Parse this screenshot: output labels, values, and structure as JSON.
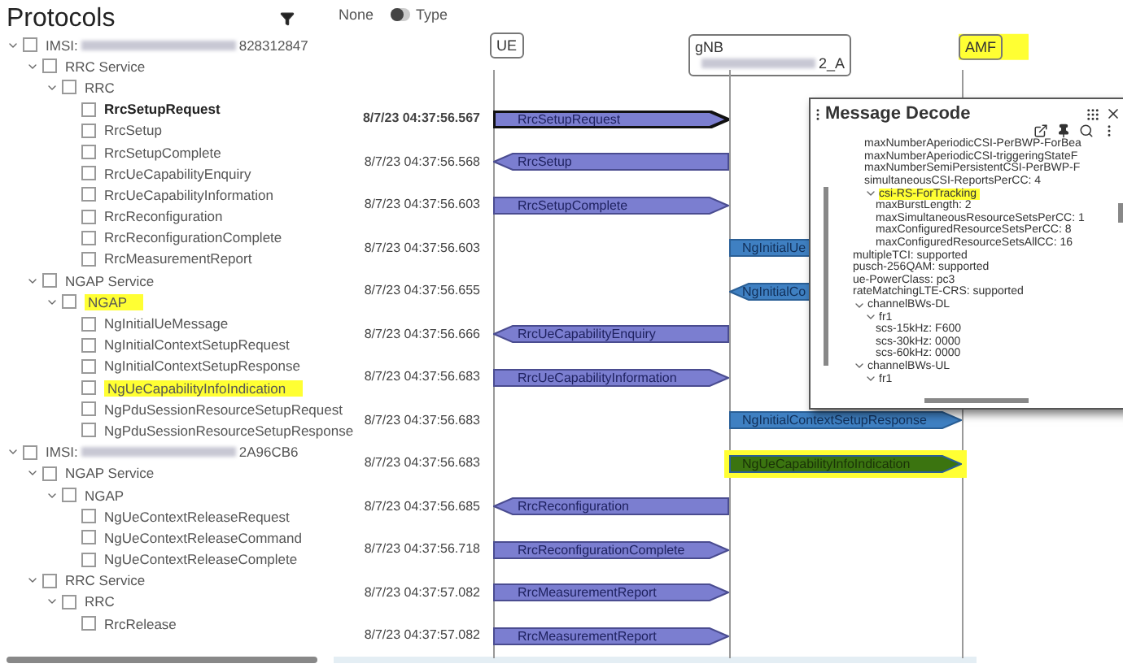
{
  "sidebar": {
    "title": "Protocols",
    "tree": [
      {
        "label": "IMSI:",
        "tail": "828312847",
        "redacted": true,
        "expanded": true,
        "checked": false,
        "children": [
          {
            "label": "RRC Service",
            "expanded": true,
            "checked": false,
            "children": [
              {
                "label": "RRC",
                "expanded": true,
                "checked": false,
                "children": [
                  {
                    "label": "RrcSetupRequest",
                    "checked": false,
                    "bold": true,
                    "highlighted": false
                  },
                  {
                    "label": "RrcSetup",
                    "checked": false,
                    "bold": false,
                    "highlighted": false
                  },
                  {
                    "label": "RrcSetupComplete",
                    "checked": false,
                    "bold": false,
                    "highlighted": false
                  },
                  {
                    "label": "RrcUeCapabilityEnquiry",
                    "checked": false,
                    "bold": false,
                    "highlighted": false
                  },
                  {
                    "label": "RrcUeCapabilityInformation",
                    "checked": false,
                    "bold": false,
                    "highlighted": false
                  },
                  {
                    "label": "RrcReconfiguration",
                    "checked": false,
                    "bold": false,
                    "highlighted": false
                  },
                  {
                    "label": "RrcReconfigurationComplete",
                    "checked": false,
                    "bold": false,
                    "highlighted": false
                  },
                  {
                    "label": "RrcMeasurementReport",
                    "checked": false,
                    "bold": false,
                    "highlighted": false
                  }
                ]
              }
            ]
          },
          {
            "label": "NGAP Service",
            "expanded": true,
            "checked": false,
            "children": [
              {
                "label": "NGAP",
                "expanded": true,
                "checked": false,
                "highlighted": true,
                "children": [
                  {
                    "label": "NgInitialUeMessage",
                    "checked": false,
                    "bold": false,
                    "highlighted": false
                  },
                  {
                    "label": "NgInitialContextSetupRequest",
                    "checked": false,
                    "bold": false,
                    "highlighted": false
                  },
                  {
                    "label": "NgInitialContextSetupResponse",
                    "checked": false,
                    "bold": false,
                    "highlighted": false
                  },
                  {
                    "label": "NgUeCapabilityInfoIndication",
                    "checked": false,
                    "bold": false,
                    "highlighted": true
                  },
                  {
                    "label": "NgPduSessionResourceSetupRequest",
                    "checked": false,
                    "bold": false,
                    "highlighted": false
                  },
                  {
                    "label": "NgPduSessionResourceSetupResponse",
                    "checked": false,
                    "bold": false,
                    "highlighted": false
                  }
                ]
              }
            ]
          }
        ]
      },
      {
        "label": "IMSI:",
        "tail": "2A96CB6",
        "redacted": true,
        "expanded": true,
        "checked": false,
        "children": [
          {
            "label": "NGAP Service",
            "expanded": true,
            "checked": false,
            "children": [
              {
                "label": "NGAP",
                "expanded": true,
                "checked": false,
                "children": [
                  {
                    "label": "NgUeContextReleaseRequest",
                    "checked": false,
                    "bold": false,
                    "highlighted": false
                  },
                  {
                    "label": "NgUeContextReleaseCommand",
                    "checked": false,
                    "bold": false,
                    "highlighted": false
                  },
                  {
                    "label": "NgUeContextReleaseComplete",
                    "checked": false,
                    "bold": false,
                    "highlighted": false
                  }
                ]
              }
            ]
          },
          {
            "label": "RRC Service",
            "expanded": true,
            "checked": false,
            "children": [
              {
                "label": "RRC",
                "expanded": true,
                "checked": false,
                "children": [
                  {
                    "label": "RrcRelease",
                    "checked": false,
                    "bold": false,
                    "highlighted": false
                  }
                ]
              }
            ]
          }
        ]
      }
    ]
  },
  "toolbar": {
    "option": "None",
    "toggle_label": "Type",
    "toggle_on": false
  },
  "lanes": [
    {
      "name": "UE",
      "highlighted": false
    },
    {
      "name": "gNB",
      "tail": "2_A",
      "redacted": true,
      "highlighted": false
    },
    {
      "name": "AMF",
      "highlighted": true
    }
  ],
  "messages": [
    {
      "time": "8/7/23 04:37:56.567",
      "label": "RrcSetupRequest",
      "kind": "rrc",
      "rightward": true,
      "selected": true,
      "highlighted": false
    },
    {
      "time": "8/7/23 04:37:56.568",
      "label": "RrcSetup",
      "kind": "rrc",
      "rightward": false,
      "selected": false,
      "highlighted": false
    },
    {
      "time": "8/7/23 04:37:56.603",
      "label": "RrcSetupComplete",
      "kind": "rrc",
      "rightward": true,
      "selected": false,
      "highlighted": false
    },
    {
      "time": "8/7/23 04:37:56.603",
      "label": "NgInitialUe",
      "kind": "ngap",
      "rightward": true,
      "selected": false,
      "highlighted": false
    },
    {
      "time": "8/7/23 04:37:56.655",
      "label": "NgInitialCo",
      "kind": "ngap",
      "rightward": false,
      "selected": false,
      "highlighted": false
    },
    {
      "time": "8/7/23 04:37:56.666",
      "label": "RrcUeCapabilityEnquiry",
      "kind": "rrc",
      "rightward": false,
      "selected": false,
      "highlighted": false
    },
    {
      "time": "8/7/23 04:37:56.683",
      "label": "RrcUeCapabilityInformation",
      "kind": "rrc",
      "rightward": true,
      "selected": false,
      "highlighted": false
    },
    {
      "time": "8/7/23 04:37:56.683",
      "label": "NgInitialContextSetupResponse",
      "kind": "ngap",
      "rightward": true,
      "selected": false,
      "highlighted": false
    },
    {
      "time": "8/7/23 04:37:56.683",
      "label": "NgUeCapabilityInfoIndication",
      "kind": "ngap",
      "rightward": true,
      "selected": false,
      "highlighted": true
    },
    {
      "time": "8/7/23 04:37:56.685",
      "label": "RrcReconfiguration",
      "kind": "rrc",
      "rightward": false,
      "selected": false,
      "highlighted": false
    },
    {
      "time": "8/7/23 04:37:56.718",
      "label": "RrcReconfigurationComplete",
      "kind": "rrc",
      "rightward": true,
      "selected": false,
      "highlighted": false
    },
    {
      "time": "8/7/23 04:37:57.082",
      "label": "RrcMeasurementReport",
      "kind": "rrc",
      "rightward": true,
      "selected": false,
      "highlighted": false
    },
    {
      "time": "8/7/23 04:37:57.082",
      "label": "RrcMeasurementReport",
      "kind": "rrc",
      "rightward": true,
      "selected": false,
      "highlighted": false
    }
  ],
  "decode": {
    "title": "Message Decode",
    "tree": [
      {
        "children": [
          {
            "label": "maxNumberAperiodicCSI-PerBWP-ForBea"
          },
          {
            "label": "maxNumberAperiodicCSI-triggeringStateF"
          },
          {
            "label": "maxNumberSemiPersistentCSI-PerBWP-F"
          },
          {
            "label": "simultaneousCSI-ReportsPerCC: 4"
          },
          {
            "label": "csi-RS-ForTracking",
            "expanded": true,
            "highlighted": true,
            "children": [
              {
                "label": "maxBurstLength: 2"
              },
              {
                "label": "maxSimultaneousResourceSetsPerCC: 1"
              },
              {
                "label": "maxConfiguredResourceSetsPerCC: 8"
              },
              {
                "label": "maxConfiguredResourceSetsAllCC: 16"
              }
            ]
          }
        ]
      },
      {
        "label": "multipleTCI: supported"
      },
      {
        "label": "pusch-256QAM: supported"
      },
      {
        "label": "ue-PowerClass: pc3"
      },
      {
        "label": "rateMatchingLTE-CRS: supported"
      },
      {
        "label": "channelBWs-DL",
        "expanded": true,
        "children": [
          {
            "label": "fr1",
            "expanded": true,
            "children": [
              {
                "label": "scs-15kHz: F600"
              },
              {
                "label": "scs-30kHz: 0000"
              },
              {
                "label": "scs-60kHz: 0000"
              }
            ]
          }
        ]
      },
      {
        "label": "channelBWs-UL",
        "expanded": true,
        "children": [
          {
            "label": "fr1",
            "expanded": true
          }
        ]
      }
    ]
  }
}
